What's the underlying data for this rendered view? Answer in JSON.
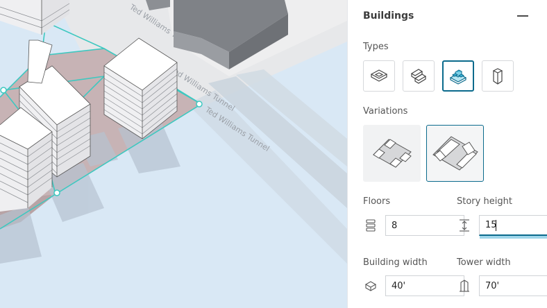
{
  "map": {
    "street_labels": [
      "Ted Williams Tunnel",
      "Ted Williams Tunnel",
      "Ted Williams Tunnel"
    ]
  },
  "panel": {
    "title": "Buildings",
    "types": {
      "label": "Types",
      "items": [
        {
          "name": "courtyard-type-icon",
          "selected": false
        },
        {
          "name": "bar-type-icon",
          "selected": false
        },
        {
          "name": "podium-tower-type-icon",
          "selected": true
        },
        {
          "name": "tower-type-icon",
          "selected": false
        }
      ]
    },
    "variations": {
      "label": "Variations",
      "items": [
        {
          "name": "variation-1",
          "selected": false
        },
        {
          "name": "variation-2",
          "selected": true
        }
      ]
    },
    "floors": {
      "label": "Floors",
      "value": "8",
      "icon": "floors-icon"
    },
    "story_height": {
      "label": "Story height",
      "value": "15",
      "icon": "height-arrows-icon"
    },
    "building_width": {
      "label": "Building width",
      "value": "40'",
      "icon": "building-width-icon"
    },
    "tower_width": {
      "label": "Tower width",
      "value": "70'",
      "icon": "tower-width-icon"
    }
  },
  "colors": {
    "accent": "#0a6a8c",
    "accent_light": "#9fd6ea",
    "selection_outline": "#3ec8c0",
    "site_fill": "#c9b6b8",
    "water": "#d9e8f5"
  }
}
